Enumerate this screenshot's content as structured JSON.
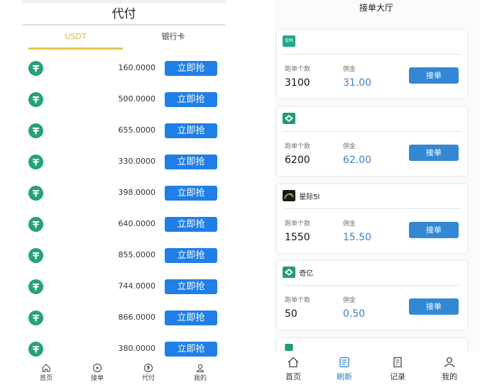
{
  "left": {
    "title": "代付",
    "tabs": [
      {
        "label": "USDT",
        "active": true
      },
      {
        "label": "银行卡",
        "active": false
      }
    ],
    "grab_label": "立即抢",
    "amounts": [
      "160.0000",
      "500.0000",
      "655.0000",
      "330.0000",
      "398.0000",
      "640.0000",
      "855.0000",
      "744.0000",
      "866.0000",
      "380.0000"
    ],
    "nav": [
      {
        "label": "首页",
        "icon": "home-icon"
      },
      {
        "label": "接单",
        "icon": "take-order-icon"
      },
      {
        "label": "代付",
        "icon": "payout-icon"
      },
      {
        "label": "我的",
        "icon": "user-icon"
      }
    ]
  },
  "right": {
    "title": "接单大厅",
    "run_count_label": "跑单个数",
    "commission_label": "佣金",
    "take_label": "接单",
    "cards": [
      {
        "name": "",
        "logo_text": "金码",
        "count": "3100",
        "commission": "31.00"
      },
      {
        "name": "",
        "logo_text": "",
        "count": "6200",
        "commission": "62.00"
      },
      {
        "name": "星际5l",
        "logo_text": "",
        "count": "1550",
        "commission": "15.50"
      },
      {
        "name": "奇亿",
        "logo_text": "",
        "count": "50",
        "commission": "0.50"
      }
    ],
    "nav": [
      {
        "label": "首页",
        "icon": "home-icon"
      },
      {
        "label": "刷新",
        "icon": "refresh-icon"
      },
      {
        "label": "记录",
        "icon": "record-icon"
      },
      {
        "label": "我的",
        "icon": "user-icon"
      }
    ]
  },
  "colors": {
    "tether_green": "#26a17b",
    "grab_button_blue": "#1f7fe6",
    "take_button_blue": "#3388d4",
    "active_tab_gold": "#e0b53a",
    "commission_blue": "#3a83c6"
  }
}
